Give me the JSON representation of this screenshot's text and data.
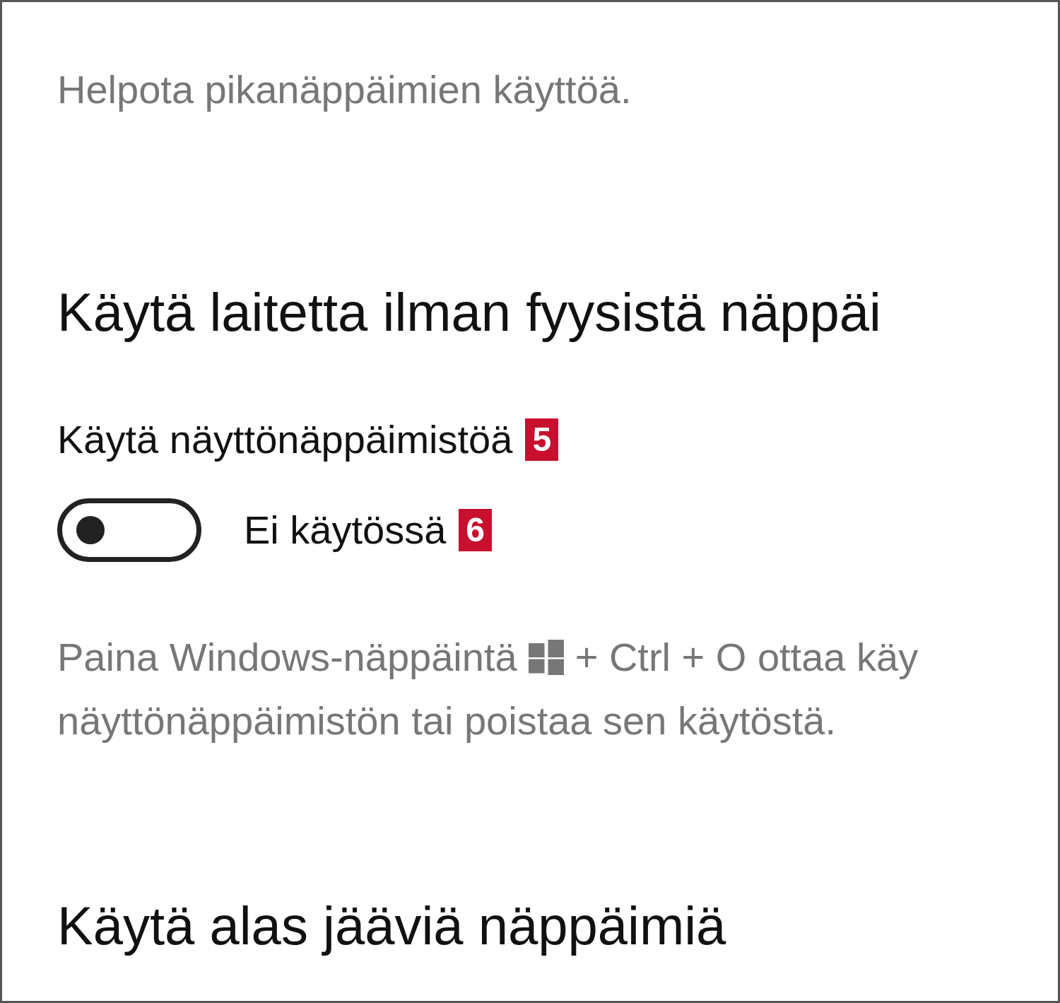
{
  "intro": "Helpota pikanäppäimien käyttöä.",
  "sections": [
    {
      "heading": "Käytä laitetta ilman fyysistä näppäi",
      "setting": {
        "label": "Käytä näyttönäppäimistöä",
        "label_badge": "5",
        "on": false,
        "state_text": "Ei käytössä",
        "state_badge": "6"
      },
      "description": {
        "before": "Paina Windows-näppäintä",
        "after": "+ Ctrl + O ottaa käy",
        "line2": "näyttönäppäimistön tai poistaa sen käytöstä."
      }
    },
    {
      "heading": "Käytä alas jääviä näppäimiä"
    }
  ]
}
